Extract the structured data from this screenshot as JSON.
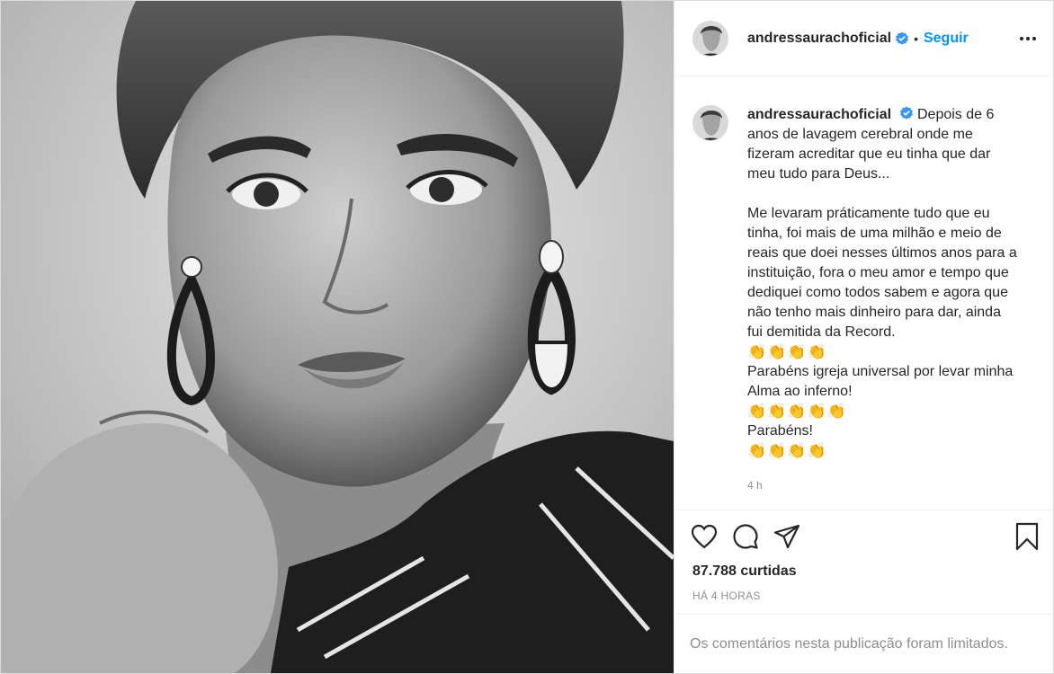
{
  "post": {
    "image_alt": "Black and white portrait photo",
    "username": "andressaurachoficial",
    "dot": "•",
    "follow_label": "Seguir",
    "caption": {
      "username": "andressaurachoficial",
      "intro": "Depois de 6 anos de lavagem cerebral onde me fizeram acreditar que eu tinha que dar meu tudo para Deus...",
      "body": "Me levaram práticamente tudo que eu tinha, foi mais de uma milhão e meio de reais que doei nesses últimos anos para a instituição, fora o meu amor e tempo que dediquei como todos sabem e agora que não tenho mais dinheiro para dar, ainda fui demitida da Record.",
      "clap1": "👏👏👏👏",
      "line2": "Parabéns igreja universal por levar minha Alma ao inferno!",
      "clap2": "👏👏👏👏👏",
      "line3": "Parabéns!",
      "clap3": "👏👏👏👏",
      "time": "4 h"
    },
    "likes": "87.788 curtidas",
    "posted_ago": "HÁ 4 HORAS",
    "comments_limited": "Os comentários nesta publicação foram limitados."
  },
  "icons": {
    "verified": "verified-badge-icon",
    "more": "more-options-icon",
    "like": "heart-icon",
    "comment": "comment-icon",
    "share": "paper-plane-icon",
    "save": "bookmark-icon"
  },
  "colors": {
    "accent": "#0095f6",
    "text": "#262626",
    "muted": "#8e8e8e",
    "border": "#efefef"
  }
}
